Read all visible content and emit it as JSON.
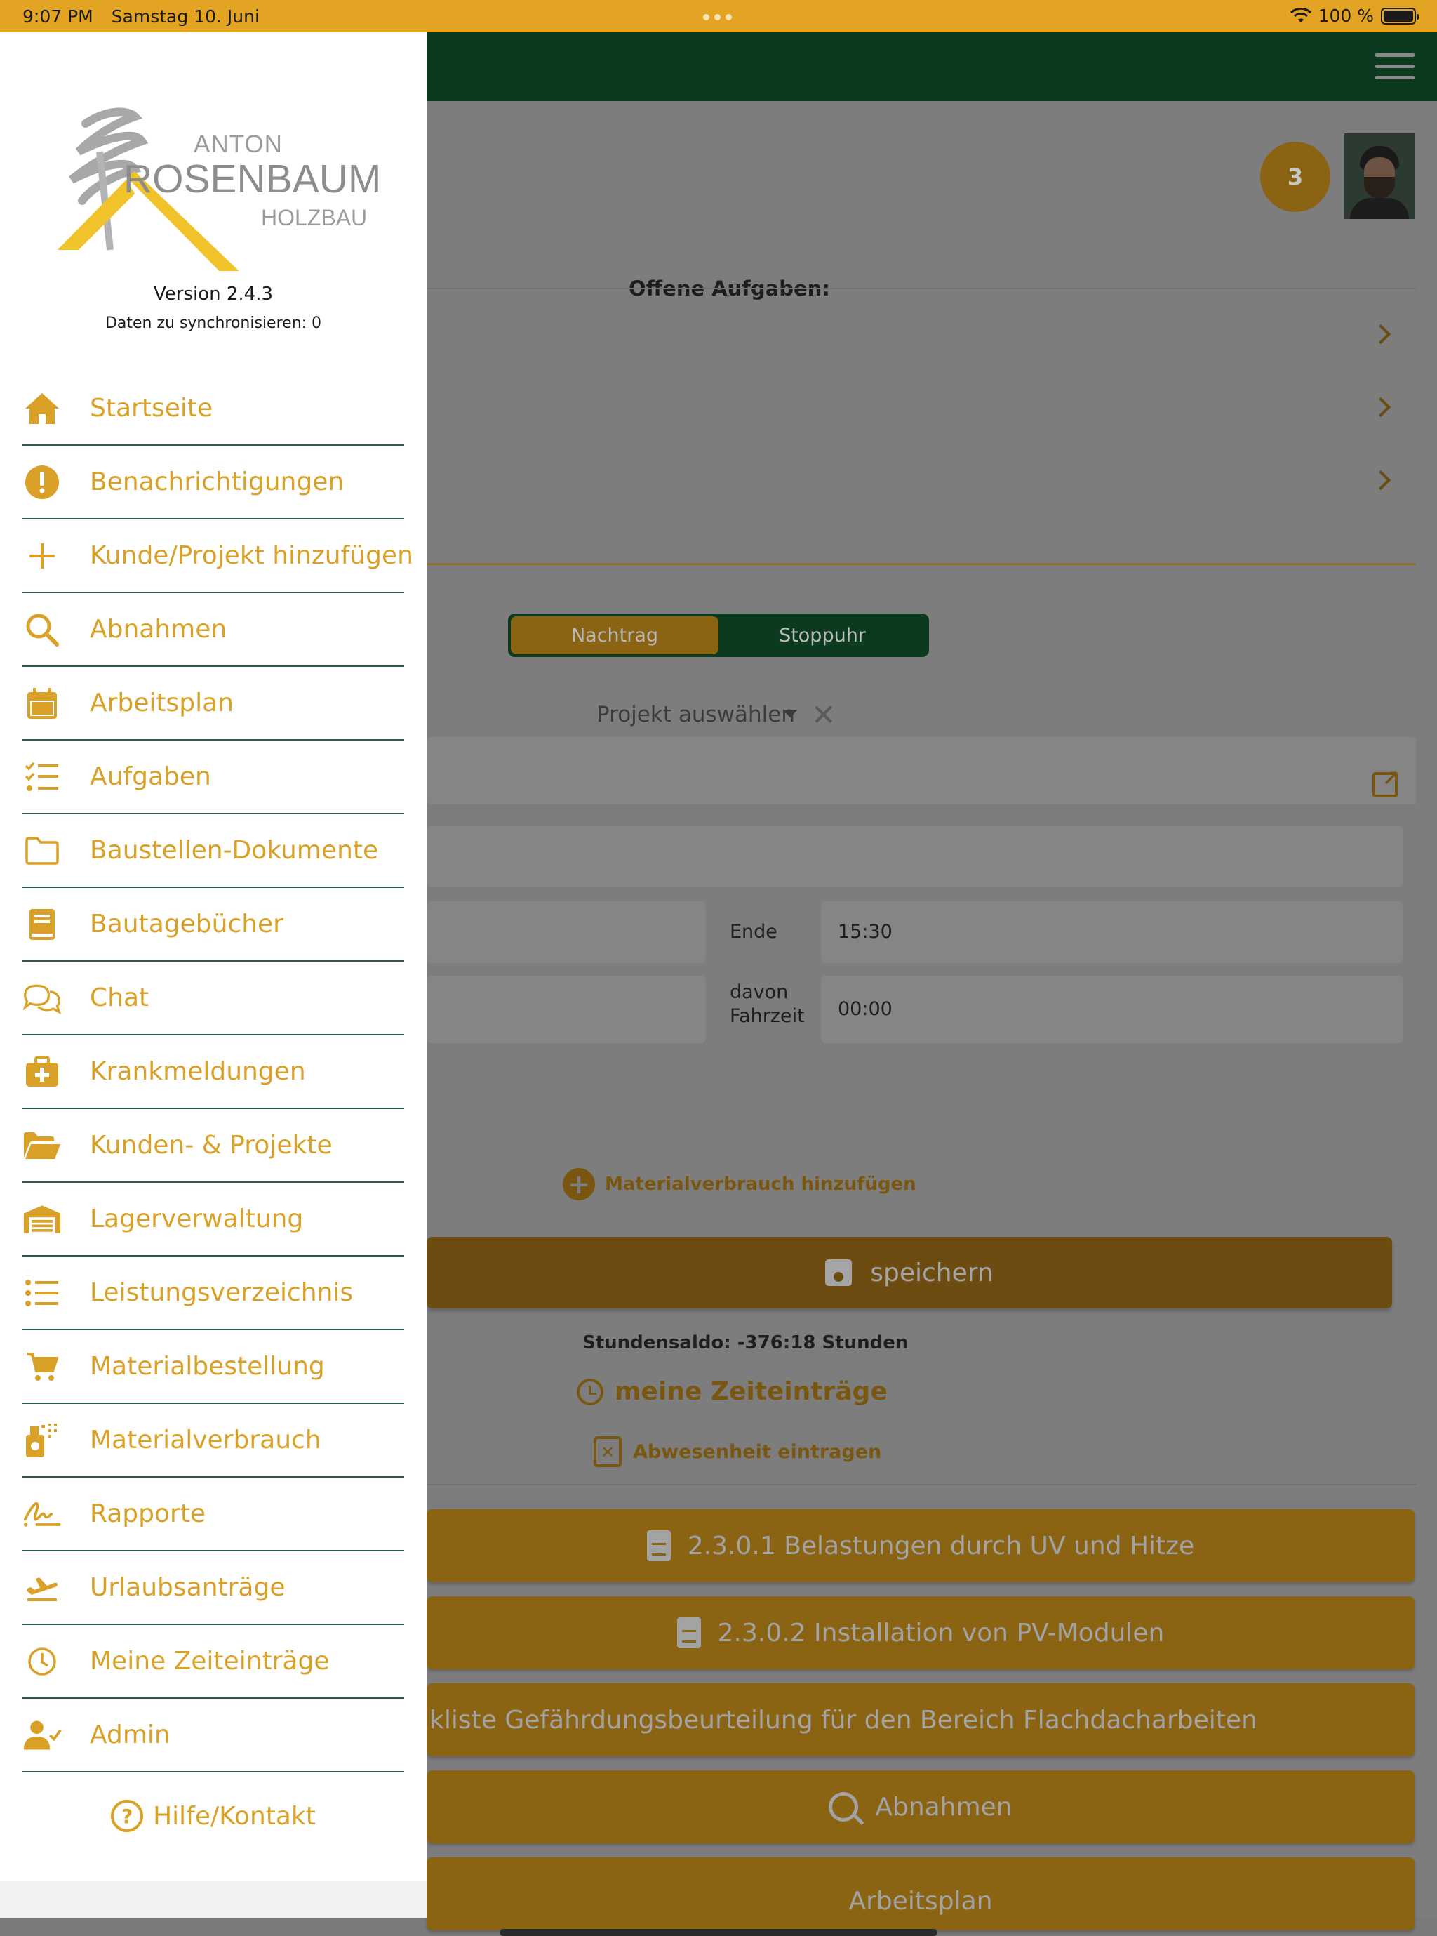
{
  "status_bar": {
    "time": "9:07 PM",
    "date": "Samstag 10. Juni",
    "battery": "100 %"
  },
  "drawer": {
    "logo": {
      "line1": "ANTON",
      "line2": "ROSENBAUM",
      "line3": "HOLZBAU"
    },
    "version": "Version 2.4.3",
    "sync": "Daten zu synchronisieren: 0",
    "items": [
      {
        "label": "Startseite",
        "icon": "home-icon"
      },
      {
        "label": "Benachrichtigungen",
        "icon": "alert-icon"
      },
      {
        "label": "Kunde/Projekt hinzufügen",
        "icon": "plus-icon"
      },
      {
        "label": "Abnahmen",
        "icon": "search-icon"
      },
      {
        "label": "Arbeitsplan",
        "icon": "calendar-icon"
      },
      {
        "label": "Aufgaben",
        "icon": "checklist-icon"
      },
      {
        "label": "Baustellen-Dokumente",
        "icon": "folder-icon"
      },
      {
        "label": "Bautagebücher",
        "icon": "book-icon"
      },
      {
        "label": "Chat",
        "icon": "chat-icon"
      },
      {
        "label": "Krankmeldungen",
        "icon": "medkit-icon"
      },
      {
        "label": "Kunden- & Projekte",
        "icon": "folder-open-icon"
      },
      {
        "label": "Lagerverwaltung",
        "icon": "warehouse-icon"
      },
      {
        "label": "Leistungsverzeichnis",
        "icon": "list-icon"
      },
      {
        "label": "Materialbestellung",
        "icon": "cart-icon"
      },
      {
        "label": "Materialverbrauch",
        "icon": "spray-icon"
      },
      {
        "label": "Rapporte",
        "icon": "signature-icon"
      },
      {
        "label": "Urlaubsanträge",
        "icon": "plane-departure-icon"
      },
      {
        "label": "Meine Zeiteinträge",
        "icon": "clock-icon"
      },
      {
        "label": "Admin",
        "icon": "user-check-icon"
      }
    ],
    "help": "Hilfe/Kontakt"
  },
  "main": {
    "notification_count": "3",
    "tasks_title": "Offene Aufgaben:",
    "segment": {
      "tab1": "Nachtrag",
      "tab2": "Stoppuhr",
      "selected": "Nachtrag"
    },
    "project_select": "Projekt auswählen",
    "ende_label": "Ende",
    "ende_value": "15:30",
    "fahrzeit_label_1": "davon",
    "fahrzeit_label_2": "Fahrzeit",
    "fahrzeit_value": "00:00",
    "add_material": "Materialverbrauch hinzufügen",
    "save": "speichern",
    "saldo": "Stundensaldo: -376:18 Stunden",
    "my_time": "meine Zeiteinträge",
    "absence": "Abwesenheit eintragen",
    "doc_buttons": [
      "2.3.0.1 Belastungen durch UV und Hitze",
      "2.3.0.2 Installation von PV-Modulen",
      "kliste Gefährdungsbeurteilung für den Bereich Flachdacharbeiten"
    ],
    "abnahmen_btn": "Abnahmen",
    "arbeitsplan_btn": "Arbeitsplan"
  },
  "colors": {
    "accent": "#d9a127",
    "status_bar": "#e3a323",
    "header_green": "#0b3a1f",
    "divider": "#2c5d4c"
  }
}
